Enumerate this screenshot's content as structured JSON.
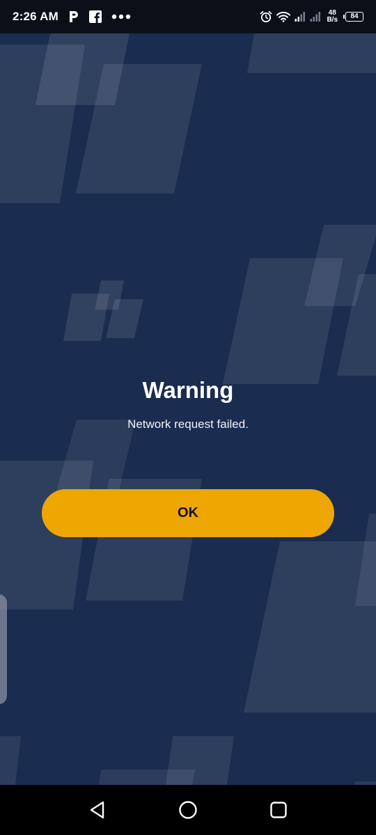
{
  "status_bar": {
    "time": "2:26 AM",
    "net_speed_value": "48",
    "net_speed_unit": "B/s",
    "battery_level": "84",
    "icons": [
      "p-app-icon",
      "facebook-icon",
      "more-dots-icon",
      "alarm-icon",
      "wifi-icon",
      "signal-icon",
      "signal-icon-2",
      "battery-icon"
    ]
  },
  "dialog": {
    "title": "Warning",
    "message": "Network request failed.",
    "ok_label": "OK"
  },
  "navigation_bar": {
    "buttons": [
      "back-icon",
      "home-icon",
      "recents-icon"
    ]
  },
  "colors": {
    "background": "#1a2c4f",
    "accent_button": "#eea702",
    "status_bar": "#0b0f18",
    "nav_bar": "#000000"
  }
}
